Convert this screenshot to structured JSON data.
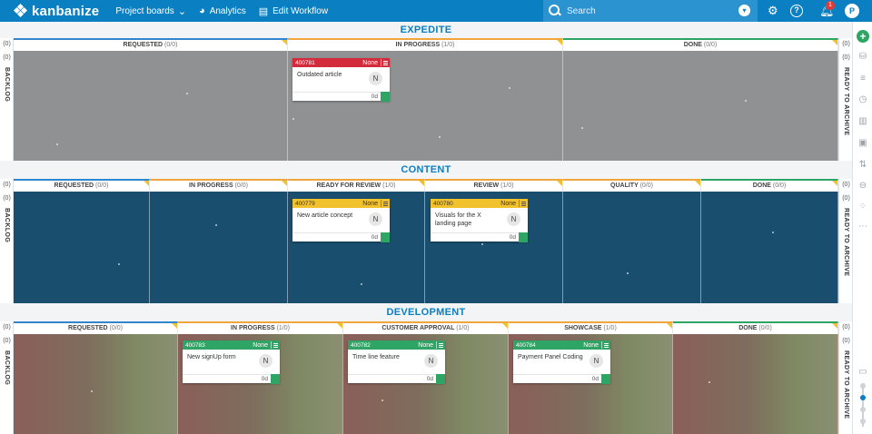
{
  "topbar": {
    "app_name": "kanbanize",
    "nav": [
      {
        "label": "Project boards",
        "icon": "chevron-down-icon"
      },
      {
        "label": "Analytics",
        "icon": "pie-chart-icon"
      },
      {
        "label": "Edit Workflow",
        "icon": "edit-workflow-icon"
      }
    ],
    "search_placeholder": "Search",
    "notification_count": "1",
    "avatar_initial": "P",
    "brand_color": "#0a7fc2"
  },
  "lanes": [
    {
      "title": "EXPEDITE",
      "backlog_count": "(0)",
      "backlog_label": "BACKLOG",
      "archive_count": "(0)",
      "archive_label": "READY TO ARCHIVE",
      "columns": [
        {
          "name": "REQUESTED",
          "count": "(0/0)"
        },
        {
          "name": "IN PROGRESS",
          "count": "(1/0)"
        },
        {
          "name": "DONE",
          "count": "(0/0)"
        }
      ],
      "cards": [
        {
          "id": "400781",
          "priority": "None",
          "title": "Outdated article",
          "owner": "N",
          "age": "0d",
          "color": "red"
        }
      ]
    },
    {
      "title": "CONTENT",
      "backlog_count": "(0)",
      "backlog_label": "BACKLOG",
      "archive_count": "(0)",
      "archive_label": "READY TO ARCHIVE",
      "columns": [
        {
          "name": "REQUESTED",
          "count": "(0/0)"
        },
        {
          "name": "IN PROGRESS",
          "count": "(0/0)"
        },
        {
          "name": "READY FOR REVIEW",
          "count": "(1/0)"
        },
        {
          "name": "REVIEW",
          "count": "(1/0)"
        },
        {
          "name": "QUALITY",
          "count": "(0/0)"
        },
        {
          "name": "DONE",
          "count": "(0/0)"
        }
      ],
      "cards": [
        {
          "id": "400779",
          "priority": "None",
          "title": "New article concept",
          "owner": "N",
          "age": "0d",
          "color": "yellow"
        },
        {
          "id": "400780",
          "priority": "None",
          "title": "Visuals for the X landing page",
          "owner": "N",
          "age": "0d",
          "color": "yellow"
        }
      ]
    },
    {
      "title": "DEVELOPMENT",
      "backlog_count": "(0)",
      "backlog_label": "BACKLOG",
      "archive_count": "(0)",
      "archive_label": "READY TO ARCHIVE",
      "columns": [
        {
          "name": "REQUESTED",
          "count": "(0/0)"
        },
        {
          "name": "IN PROGRESS",
          "count": "(1/0)"
        },
        {
          "name": "CUSTOMER APPROVAL",
          "count": "(1/0)"
        },
        {
          "name": "SHOWCASE",
          "count": "(1/0)"
        },
        {
          "name": "DONE",
          "count": "(0/0)"
        }
      ],
      "cards": [
        {
          "id": "400783",
          "priority": "None",
          "title": "New signUp form",
          "owner": "N",
          "age": "0d",
          "color": "green"
        },
        {
          "id": "400782",
          "priority": "None",
          "title": "Time line feature",
          "owner": "N",
          "age": "0d",
          "color": "green"
        },
        {
          "id": "400784",
          "priority": "None",
          "title": "Payment Panel Coding",
          "owner": "N",
          "age": "0d",
          "color": "green"
        }
      ]
    }
  ],
  "rightbar": {
    "icons": [
      "add-icon",
      "sources-icon",
      "filter-icon",
      "clock-icon",
      "columns-icon",
      "image-icon",
      "sort-icon",
      "users-icon",
      "group-icon",
      "more-icon"
    ],
    "add_symbol": "+",
    "more_symbol": "⋯"
  }
}
